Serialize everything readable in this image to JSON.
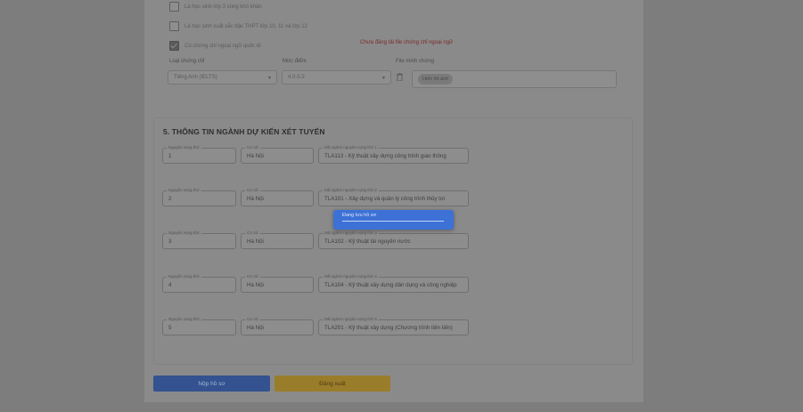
{
  "checkboxes": [
    {
      "label": "Là học sinh lớp 3 vùng khó khăn",
      "checked": false
    },
    {
      "label": "Là học sinh xuất sắc bậc THPT lớp 10, 11 và lớp 12",
      "checked": false
    },
    {
      "label": "Có chứng chỉ ngoại ngữ quốc tế",
      "checked": true
    }
  ],
  "warning": "Chưa đăng tải file chứng chỉ ngoại ngữ",
  "certificate": {
    "type_label": "Loại chứng chỉ",
    "type_value": "Tiếng Anh (IELTS)",
    "score_label": "Mức điểm",
    "score_value": "4.0-5.5",
    "proof_label": "File minh chứng",
    "proof_chip": "Hiển thị ảnh"
  },
  "section": {
    "title": "5. THÔNG TIN NGÀNH DỰ KIẾN XÉT TUYỂN"
  },
  "wishes": [
    {
      "order_label": "Nguyện vọng thứ",
      "order": "1",
      "loc_label": "Cơ sở",
      "location": "Hà Nội",
      "major_label": "Mã ngành nguyện vọng thứ 1",
      "major": "TLA113 - Kỹ thuật xây dựng công trình giao thông"
    },
    {
      "order_label": "Nguyện vọng thứ",
      "order": "2",
      "loc_label": "Cơ sở",
      "location": "Hà Nội",
      "major_label": "Mã ngành nguyện vọng thứ 2",
      "major": "TLA101 - Xây dựng và quản lý công trình thủy lợi"
    },
    {
      "order_label": "Nguyện vọng thứ",
      "order": "3",
      "loc_label": "Cơ sở",
      "location": "Hà Nội",
      "major_label": "Mã ngành nguyện vọng thứ 3",
      "major": "TLA102 - Kỹ thuật tài nguyên nước"
    },
    {
      "order_label": "Nguyện vọng thứ",
      "order": "4",
      "loc_label": "Cơ sở",
      "location": "Hà Nội",
      "major_label": "Mã ngành nguyện vọng thứ 4",
      "major": "TLA104 - Kỹ thuật xây dựng dân dụng và công nghiệp"
    },
    {
      "order_label": "Nguyện vọng thứ",
      "order": "5",
      "loc_label": "Cơ sở",
      "location": "Hà Nội",
      "major_label": "Mã ngành nguyện vọng thứ 5",
      "major": "TLA201 - Kỹ thuật xây dựng (Chương trình tiên tiến)"
    }
  ],
  "toast": {
    "text": "Đang lưu hồ sơ",
    "progress": 1.0
  },
  "buttons": {
    "submit": "Nộp hồ sơ",
    "cancel": "Đăng xuất"
  }
}
